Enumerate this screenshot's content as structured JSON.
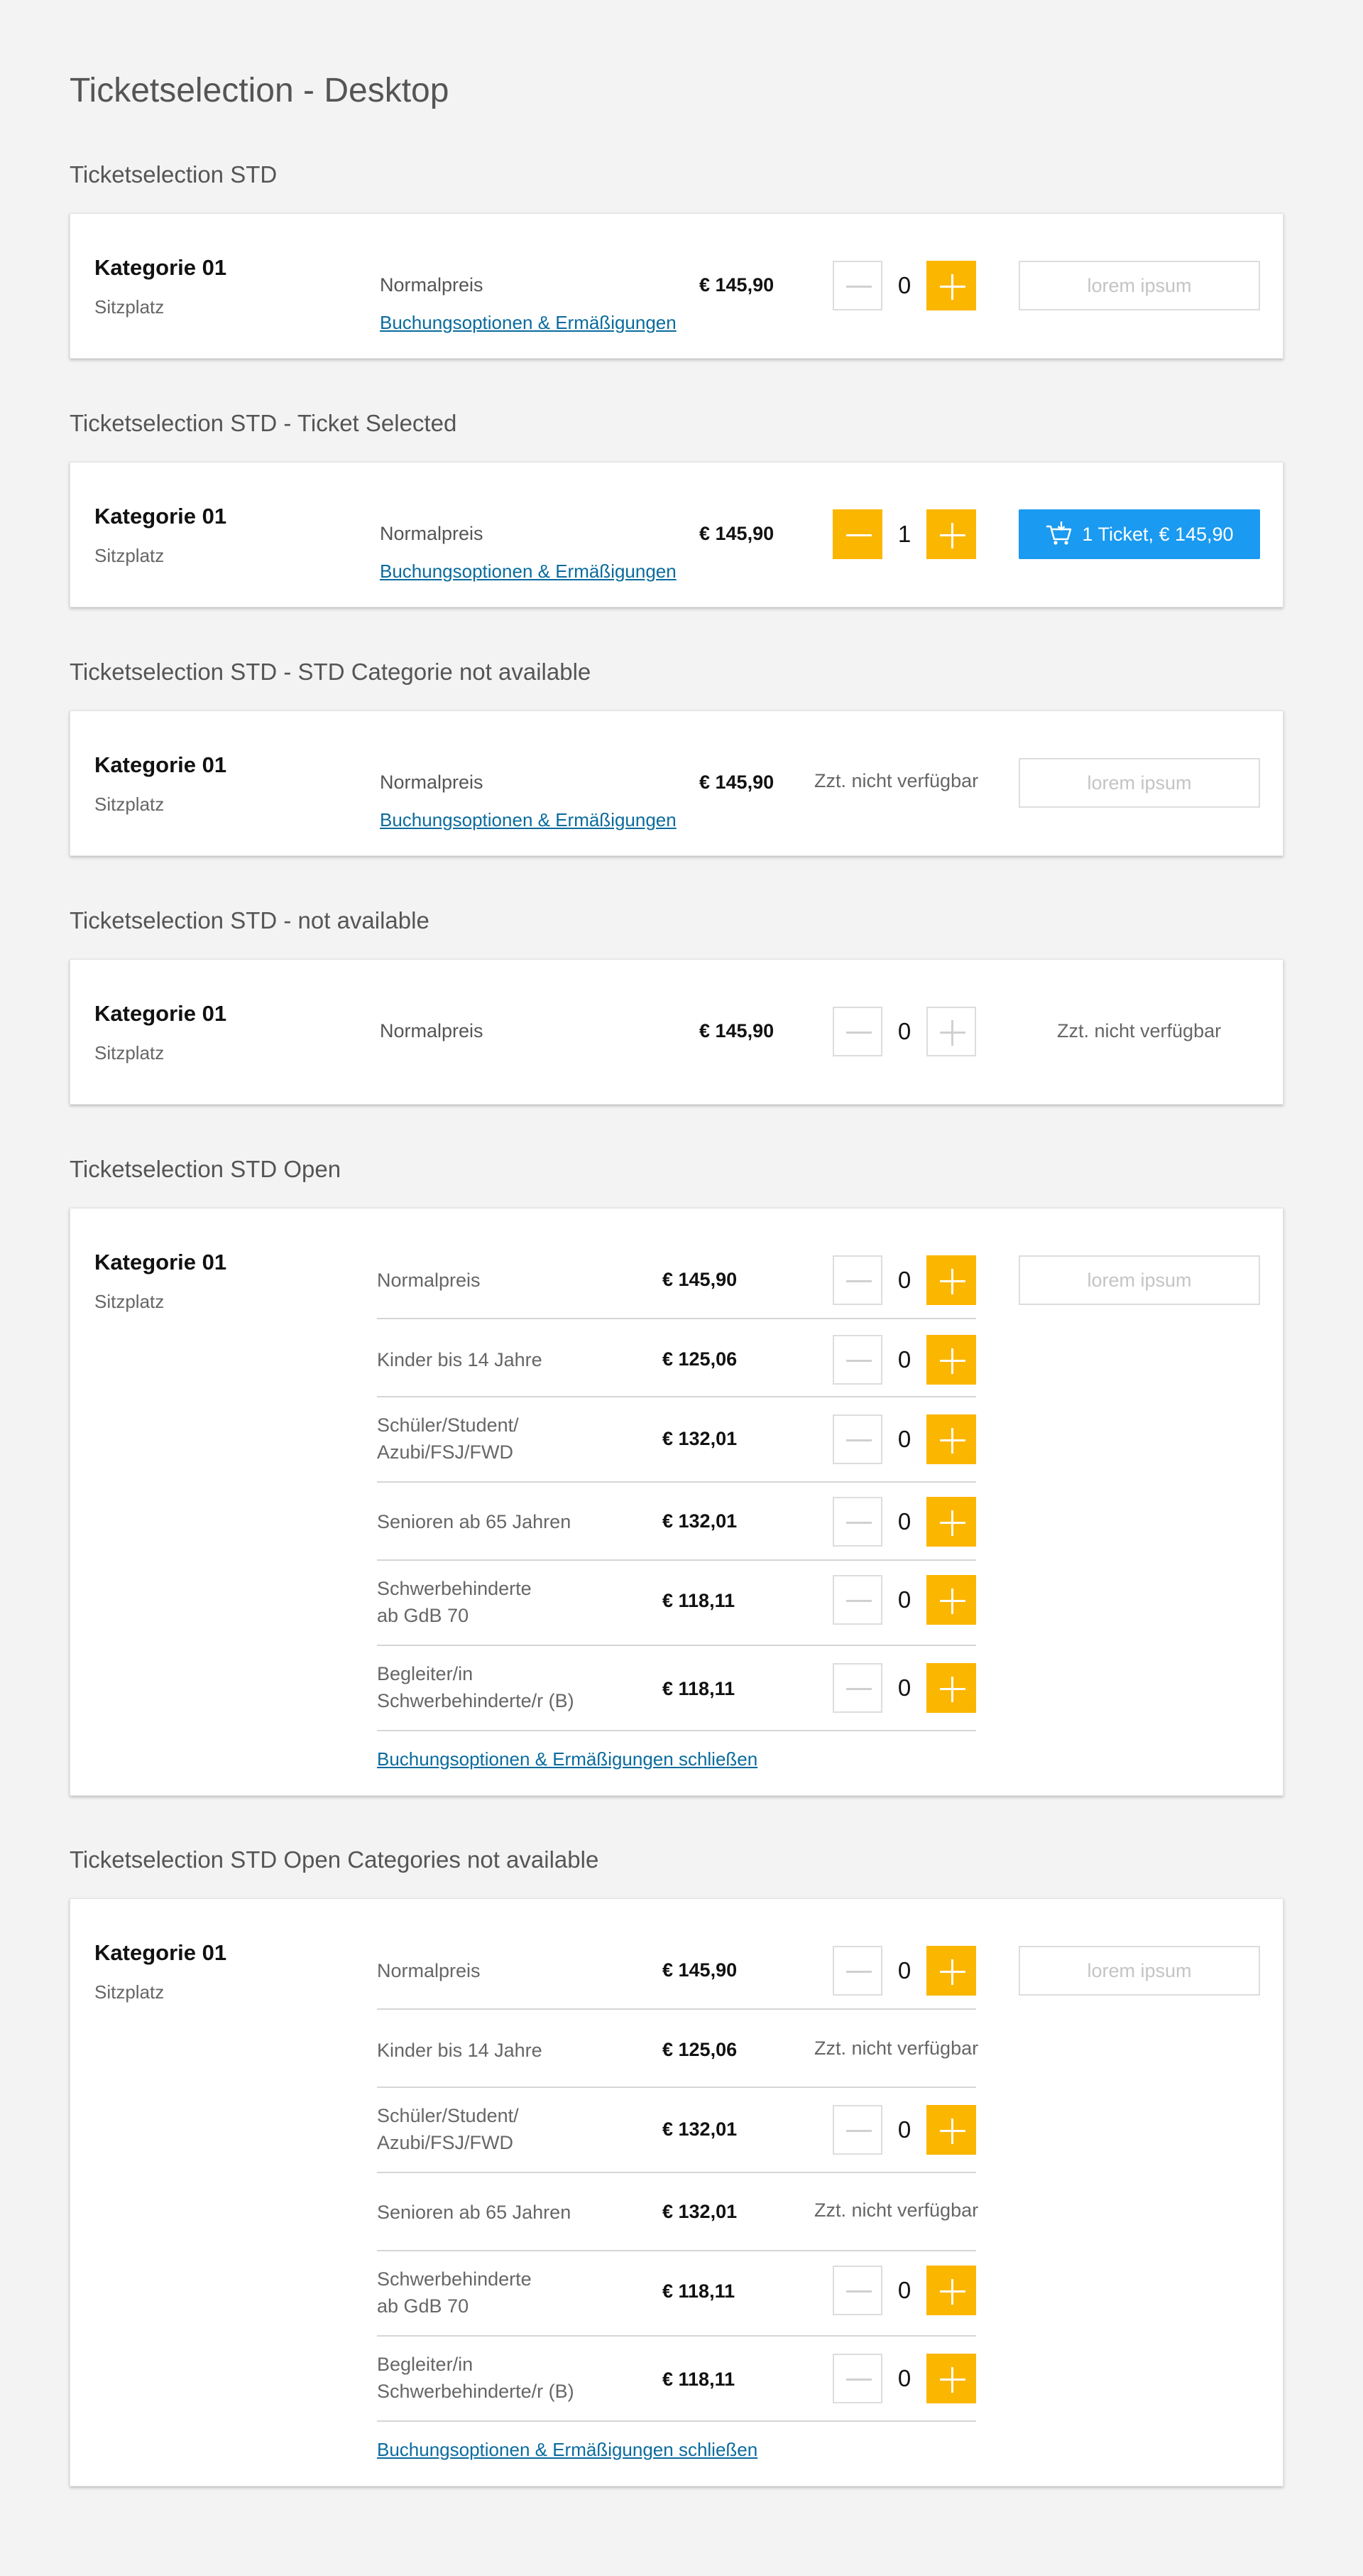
{
  "page": {
    "title": "Ticketselection - Desktop"
  },
  "colors": {
    "accent": "#fbb600",
    "primary": "#1a9af0",
    "link": "#0a6b9d",
    "background": "#f3f3f3"
  },
  "sections": [
    {
      "title": "Ticketselection STD",
      "category": "Kategorie 01",
      "subtitle": "Sitzplatz",
      "price_label": "Normalpreis",
      "price": "€ 145,90",
      "link": "Buchungsoptionen & Ermäßigungen",
      "quantity": "0",
      "cart_placeholder": "lorem ipsum"
    },
    {
      "title": "Ticketselection STD - Ticket Selected",
      "category": "Kategorie 01",
      "subtitle": "Sitzplatz",
      "price_label": "Normalpreis",
      "price": "€ 145,90",
      "link": "Buchungsoptionen & Ermäßigungen",
      "quantity": "1",
      "cart_button": "1 Ticket, € 145,90",
      "cart_icon": "cart-icon"
    },
    {
      "title": "Ticketselection STD - STD Categorie not available",
      "category": "Kategorie 01",
      "subtitle": "Sitzplatz",
      "price_label": "Normalpreis",
      "price": "€ 145,90",
      "link": "Buchungsoptionen & Ermäßigungen",
      "status": "Zzt. nicht verfügbar",
      "cart_placeholder": "lorem ipsum"
    },
    {
      "title": "Ticketselection STD - not available",
      "category": "Kategorie 01",
      "subtitle": "Sitzplatz",
      "price_label": "Normalpreis",
      "price": "€ 145,90",
      "quantity": "0",
      "status": "Zzt. nicht verfügbar"
    },
    {
      "title": "Ticketselection STD Open",
      "category": "Kategorie 01",
      "subtitle": "Sitzplatz",
      "cart_placeholder": "lorem ipsum",
      "close_link": "Buchungsoptionen & Ermäßigungen schließen",
      "rows": [
        {
          "label": "Normalpreis",
          "price": "€ 145,90",
          "quantity": "0"
        },
        {
          "label": "Kinder bis 14 Jahre",
          "price": "€ 125,06",
          "quantity": "0"
        },
        {
          "label": "Schüler/Student/\nAzubi/FSJ/FWD",
          "price": "€ 132,01",
          "quantity": "0"
        },
        {
          "label": "Senioren ab 65 Jahren",
          "price": "€ 132,01",
          "quantity": "0"
        },
        {
          "label": "Schwerbehinderte\nab GdB 70",
          "price": "€ 118,11",
          "quantity": "0"
        },
        {
          "label": "Begleiter/in\nSchwerbehinderte/r (B)",
          "price": "€ 118,11",
          "quantity": "0"
        }
      ]
    },
    {
      "title": "Ticketselection STD Open Categories not available",
      "category": "Kategorie 01",
      "subtitle": "Sitzplatz",
      "cart_placeholder": "lorem ipsum",
      "close_link": "Buchungsoptionen & Ermäßigungen schließen",
      "rows": [
        {
          "label": "Normalpreis",
          "price": "€ 145,90",
          "quantity": "0"
        },
        {
          "label": "Kinder bis 14 Jahre",
          "price": "€ 125,06",
          "status": "Zzt. nicht verfügbar"
        },
        {
          "label": "Schüler/Student/\nAzubi/FSJ/FWD",
          "price": "€ 132,01",
          "quantity": "0"
        },
        {
          "label": "Senioren ab 65 Jahren",
          "price": "€ 132,01",
          "status": "Zzt. nicht verfügbar"
        },
        {
          "label": "Schwerbehinderte\nab GdB 70",
          "price": "€ 118,11",
          "quantity": "0"
        },
        {
          "label": "Begleiter/in\nSchwerbehinderte/r (B)",
          "price": "€ 118,11",
          "quantity": "0"
        }
      ]
    }
  ]
}
